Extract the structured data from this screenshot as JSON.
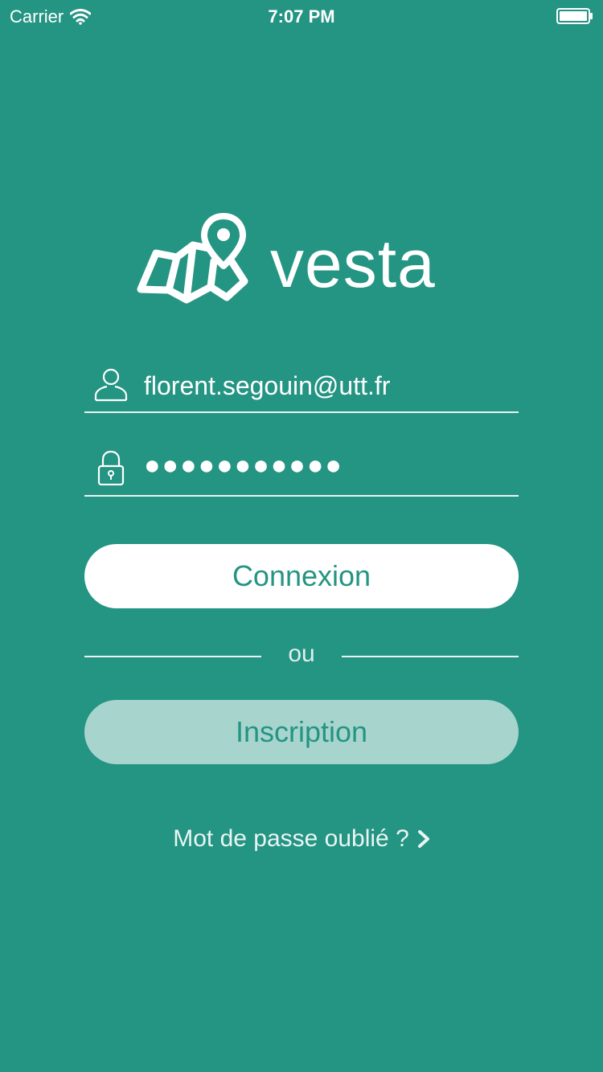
{
  "status_bar": {
    "carrier": "Carrier",
    "time": "7:07 PM",
    "wifi_icon": "wifi-icon",
    "battery_icon": "battery-icon"
  },
  "logo": {
    "icon": "map-pin-icon",
    "app_name": "vesta"
  },
  "login_form": {
    "email": {
      "icon": "user-icon",
      "value": "florent.segouin@utt.fr"
    },
    "password": {
      "icon": "lock-icon",
      "value": "●●●●●●●●●●●"
    },
    "login_label": "Connexion",
    "divider_text": "ou",
    "signup_label": "Inscription",
    "forgot_password_label": "Mot de passe oublié ?",
    "forgot_password_icon": "chevron-right-icon"
  },
  "colors": {
    "background": "#249483",
    "text": "#ffffff",
    "login_button": "#ffffff",
    "signup_button": "#a8d4ce"
  }
}
